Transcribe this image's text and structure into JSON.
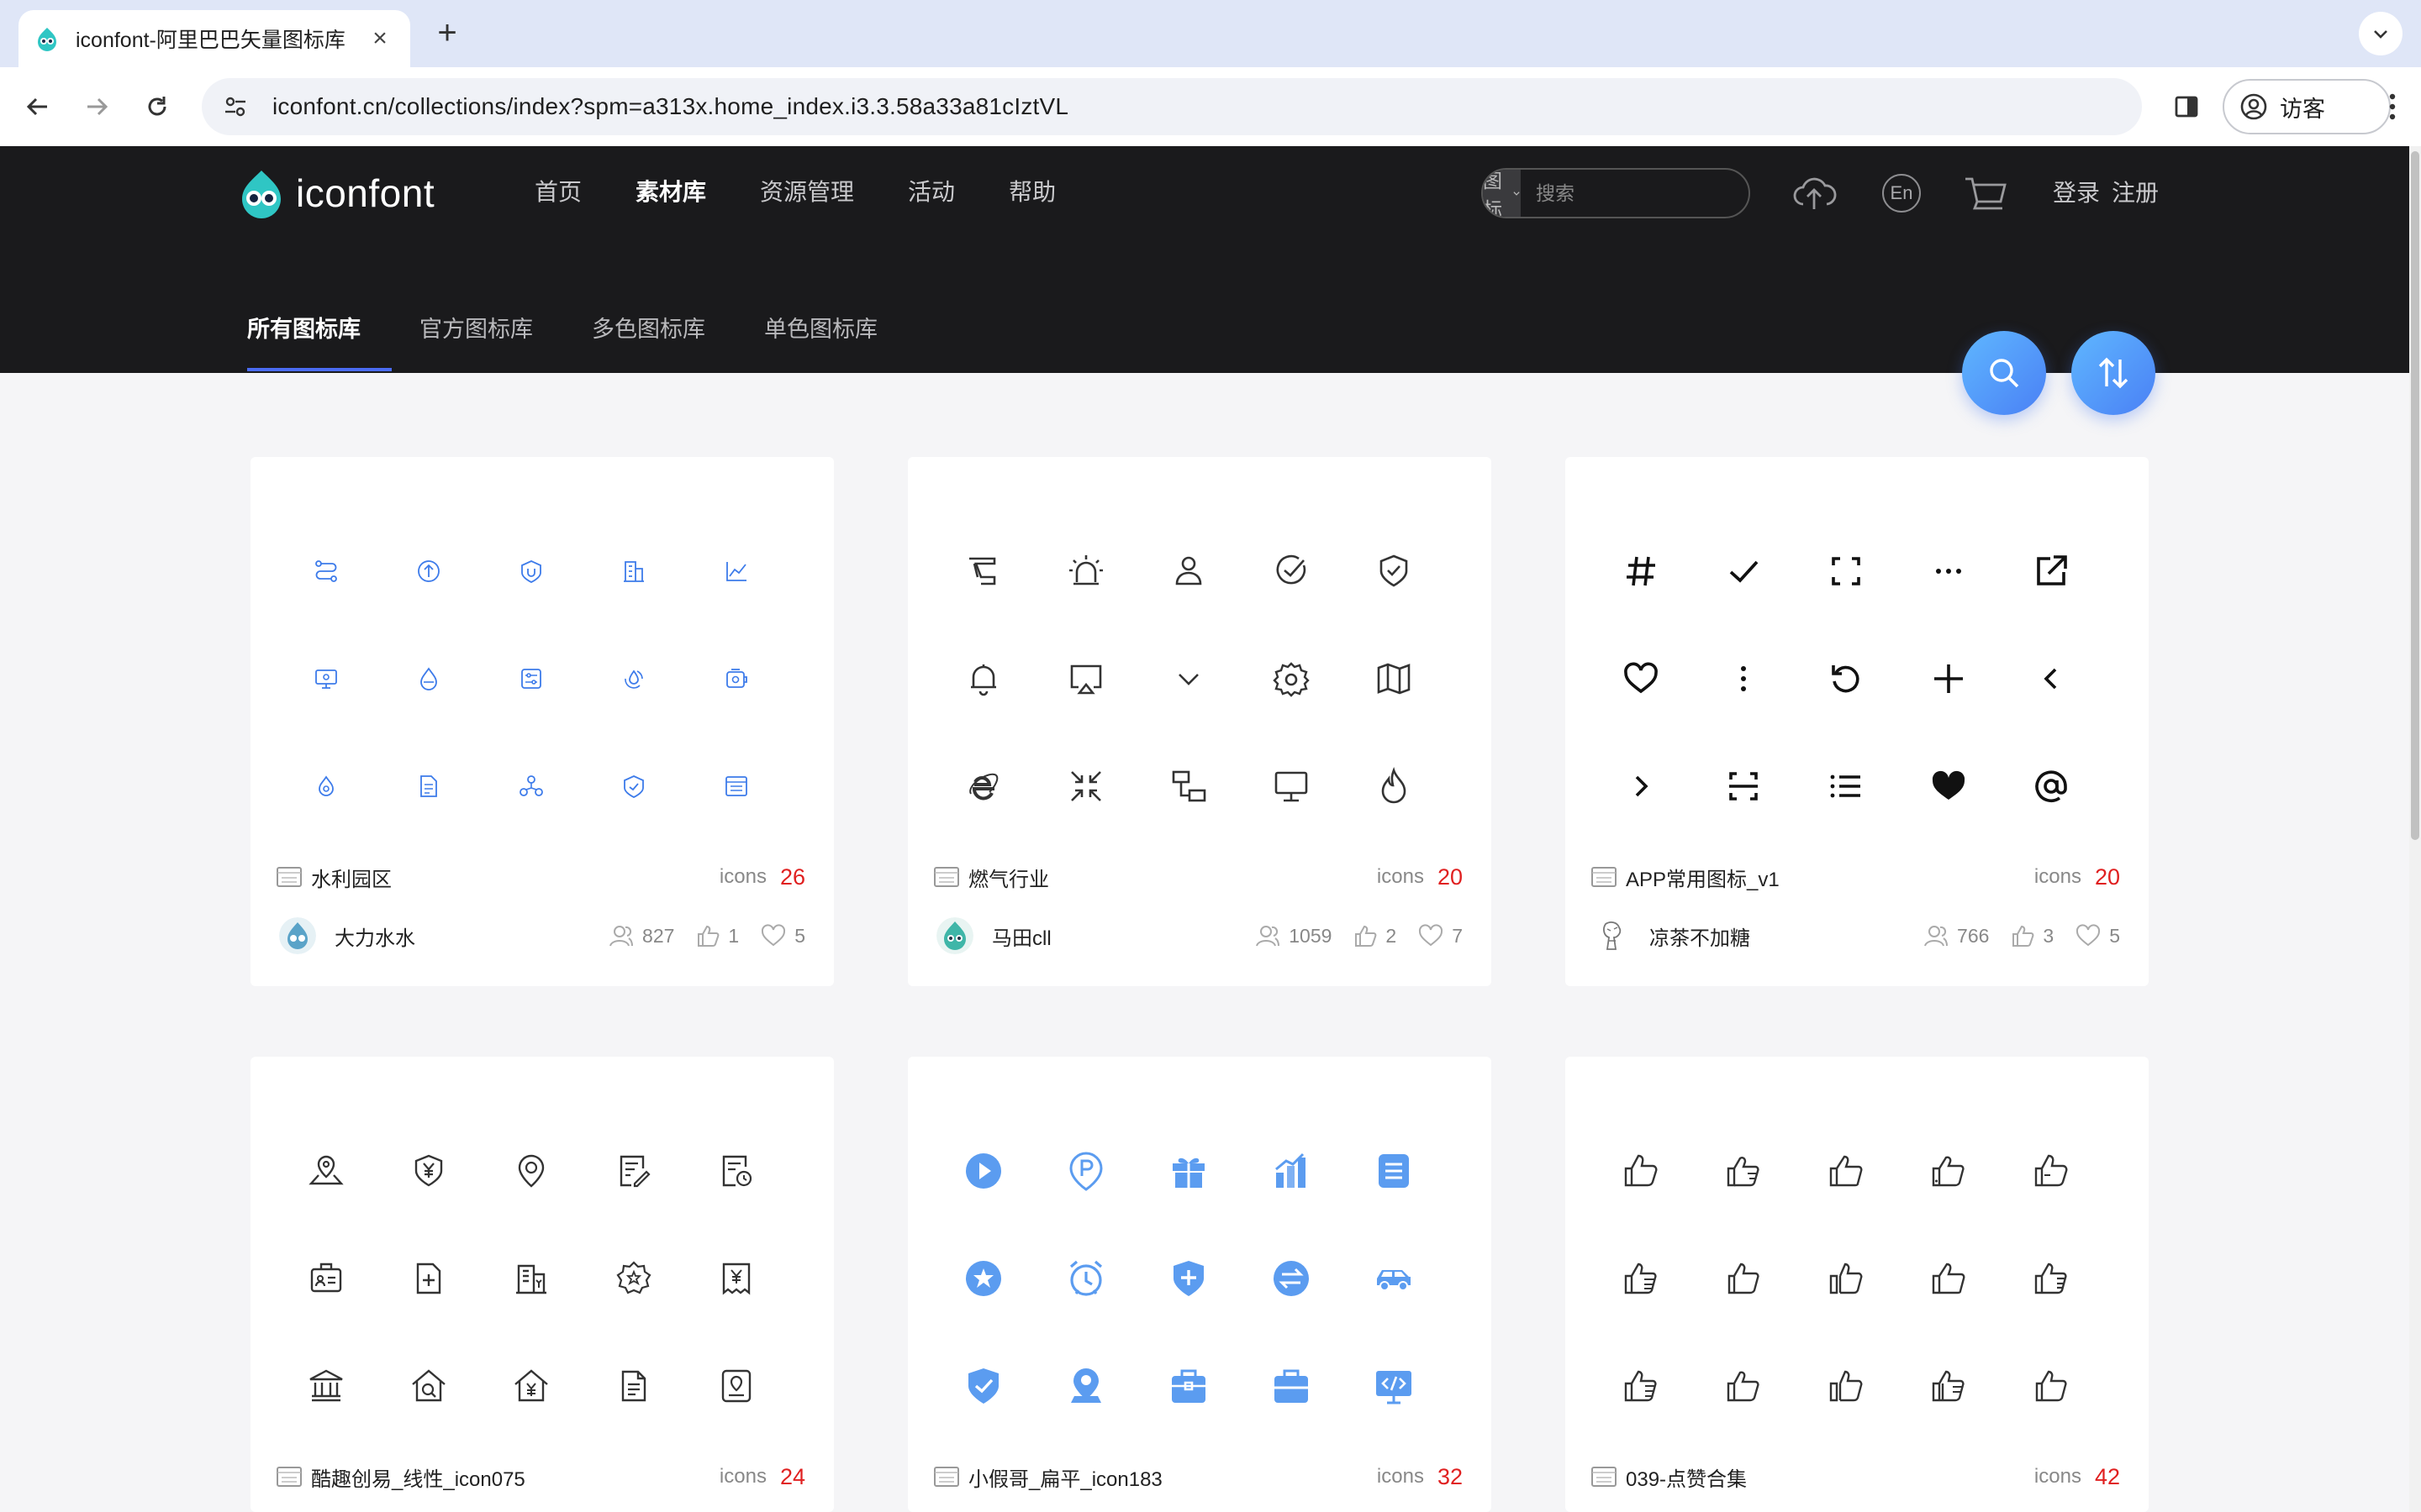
{
  "browser": {
    "tab_title": "iconfont-阿里巴巴矢量图标库",
    "tab_close": "×",
    "new_tab": "+",
    "url": "iconfont.cn/collections/index?spm=a313x.home_index.i3.3.58a33a81cIztVL",
    "profile_label": "访客"
  },
  "header": {
    "logo_text": "iconfont",
    "nav": [
      "首页",
      "素材库",
      "资源管理",
      "活动",
      "帮助"
    ],
    "active_nav": "素材库",
    "search": {
      "type_label": "图标",
      "placeholder": "搜索"
    },
    "lang_badge": "En",
    "login": "登录",
    "register": "注册",
    "subnav": [
      "所有图标库",
      "官方图标库",
      "多色图标库",
      "单色图标库"
    ],
    "active_subnav": "所有图标库"
  },
  "colors": {
    "accent": "#4b6cf5",
    "count_red": "#e02020",
    "outline_blue": "#3d7bea",
    "flat_blue": "#5b9cf0"
  },
  "cards": [
    {
      "name": "水利园区",
      "icons_label": "icons",
      "count": "26",
      "author": "大力水水",
      "views": "827",
      "likes": "1",
      "favs": "5",
      "icon_style": "small-outline-blue"
    },
    {
      "name": "燃气行业",
      "icons_label": "icons",
      "count": "20",
      "author": "马田cll",
      "views": "1059",
      "likes": "2",
      "favs": "7",
      "icon_style": "outline-dark"
    },
    {
      "name": "APP常用图标_v1",
      "icons_label": "icons",
      "count": "20",
      "author": "凉茶不加糖",
      "views": "766",
      "likes": "3",
      "favs": "5",
      "icon_style": "bold-black"
    },
    {
      "name": "酷趣创易_线性_icon075",
      "icons_label": "icons",
      "count": "24",
      "author": "",
      "views": "",
      "likes": "",
      "favs": "",
      "icon_style": "outline-dark"
    },
    {
      "name": "小假哥_扁平_icon183",
      "icons_label": "icons",
      "count": "32",
      "author": "",
      "views": "",
      "likes": "",
      "favs": "",
      "icon_style": "flat-blue"
    },
    {
      "name": "039-点赞合集",
      "icons_label": "icons",
      "count": "42",
      "author": "",
      "views": "",
      "likes": "",
      "favs": "",
      "icon_style": "thumbs-up-outline"
    }
  ]
}
